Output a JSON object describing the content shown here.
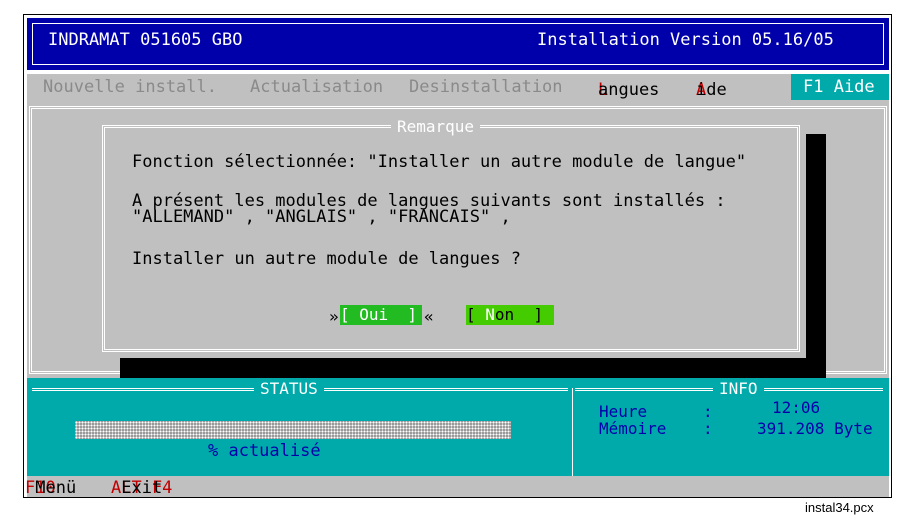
{
  "titlebar": {
    "left": "INDRAMAT 051605 GBO",
    "right": "Installation Version 05.16/05"
  },
  "menu": {
    "items": [
      {
        "label": "Nouvelle install."
      },
      {
        "label": "Actualisation"
      },
      {
        "label": "Desinstallation"
      },
      {
        "hot": "L",
        "rest": "angues"
      },
      {
        "hot": "A",
        "rest": "ide"
      }
    ],
    "f1_help": "F1 Aide"
  },
  "dialog": {
    "title": "Remarque",
    "line1": "Fonction sélectionnée: \"Installer un autre module de langue\"",
    "line2": "A présent les modules de langues suivants sont installés :",
    "line3": "\"ALLEMAND\" , \"ANGLAIS\" , \"FRANCAIS\" ,",
    "question": "Installer un autre module de langues ?",
    "btn_oui": "[ Oui  ]",
    "btn_non_pre": "[ ",
    "btn_non_hot": "N",
    "btn_non_post": "on  ]",
    "mark_left": "»",
    "mark_right": "«"
  },
  "status": {
    "title": "STATUS",
    "progress_percent": 0,
    "progress_label": "% actualisé"
  },
  "info": {
    "title": "INFO",
    "time_label": "Heure",
    "time_sep": ":",
    "time_value": "12:06",
    "mem_label": "Mémoire",
    "mem_sep": ":",
    "mem_value": "391.208 Byte"
  },
  "bottombar": {
    "f10_key": "F10",
    "f10_label": "Menü",
    "altf4_key": "ALT F4",
    "altf4_label": "Exit"
  },
  "caption": "instal34.pcx",
  "colors": {
    "title_bg": "#0000aa",
    "status_bg": "#00aaaa",
    "hotkey": "#c00000",
    "gray": "#c0c0c0"
  }
}
